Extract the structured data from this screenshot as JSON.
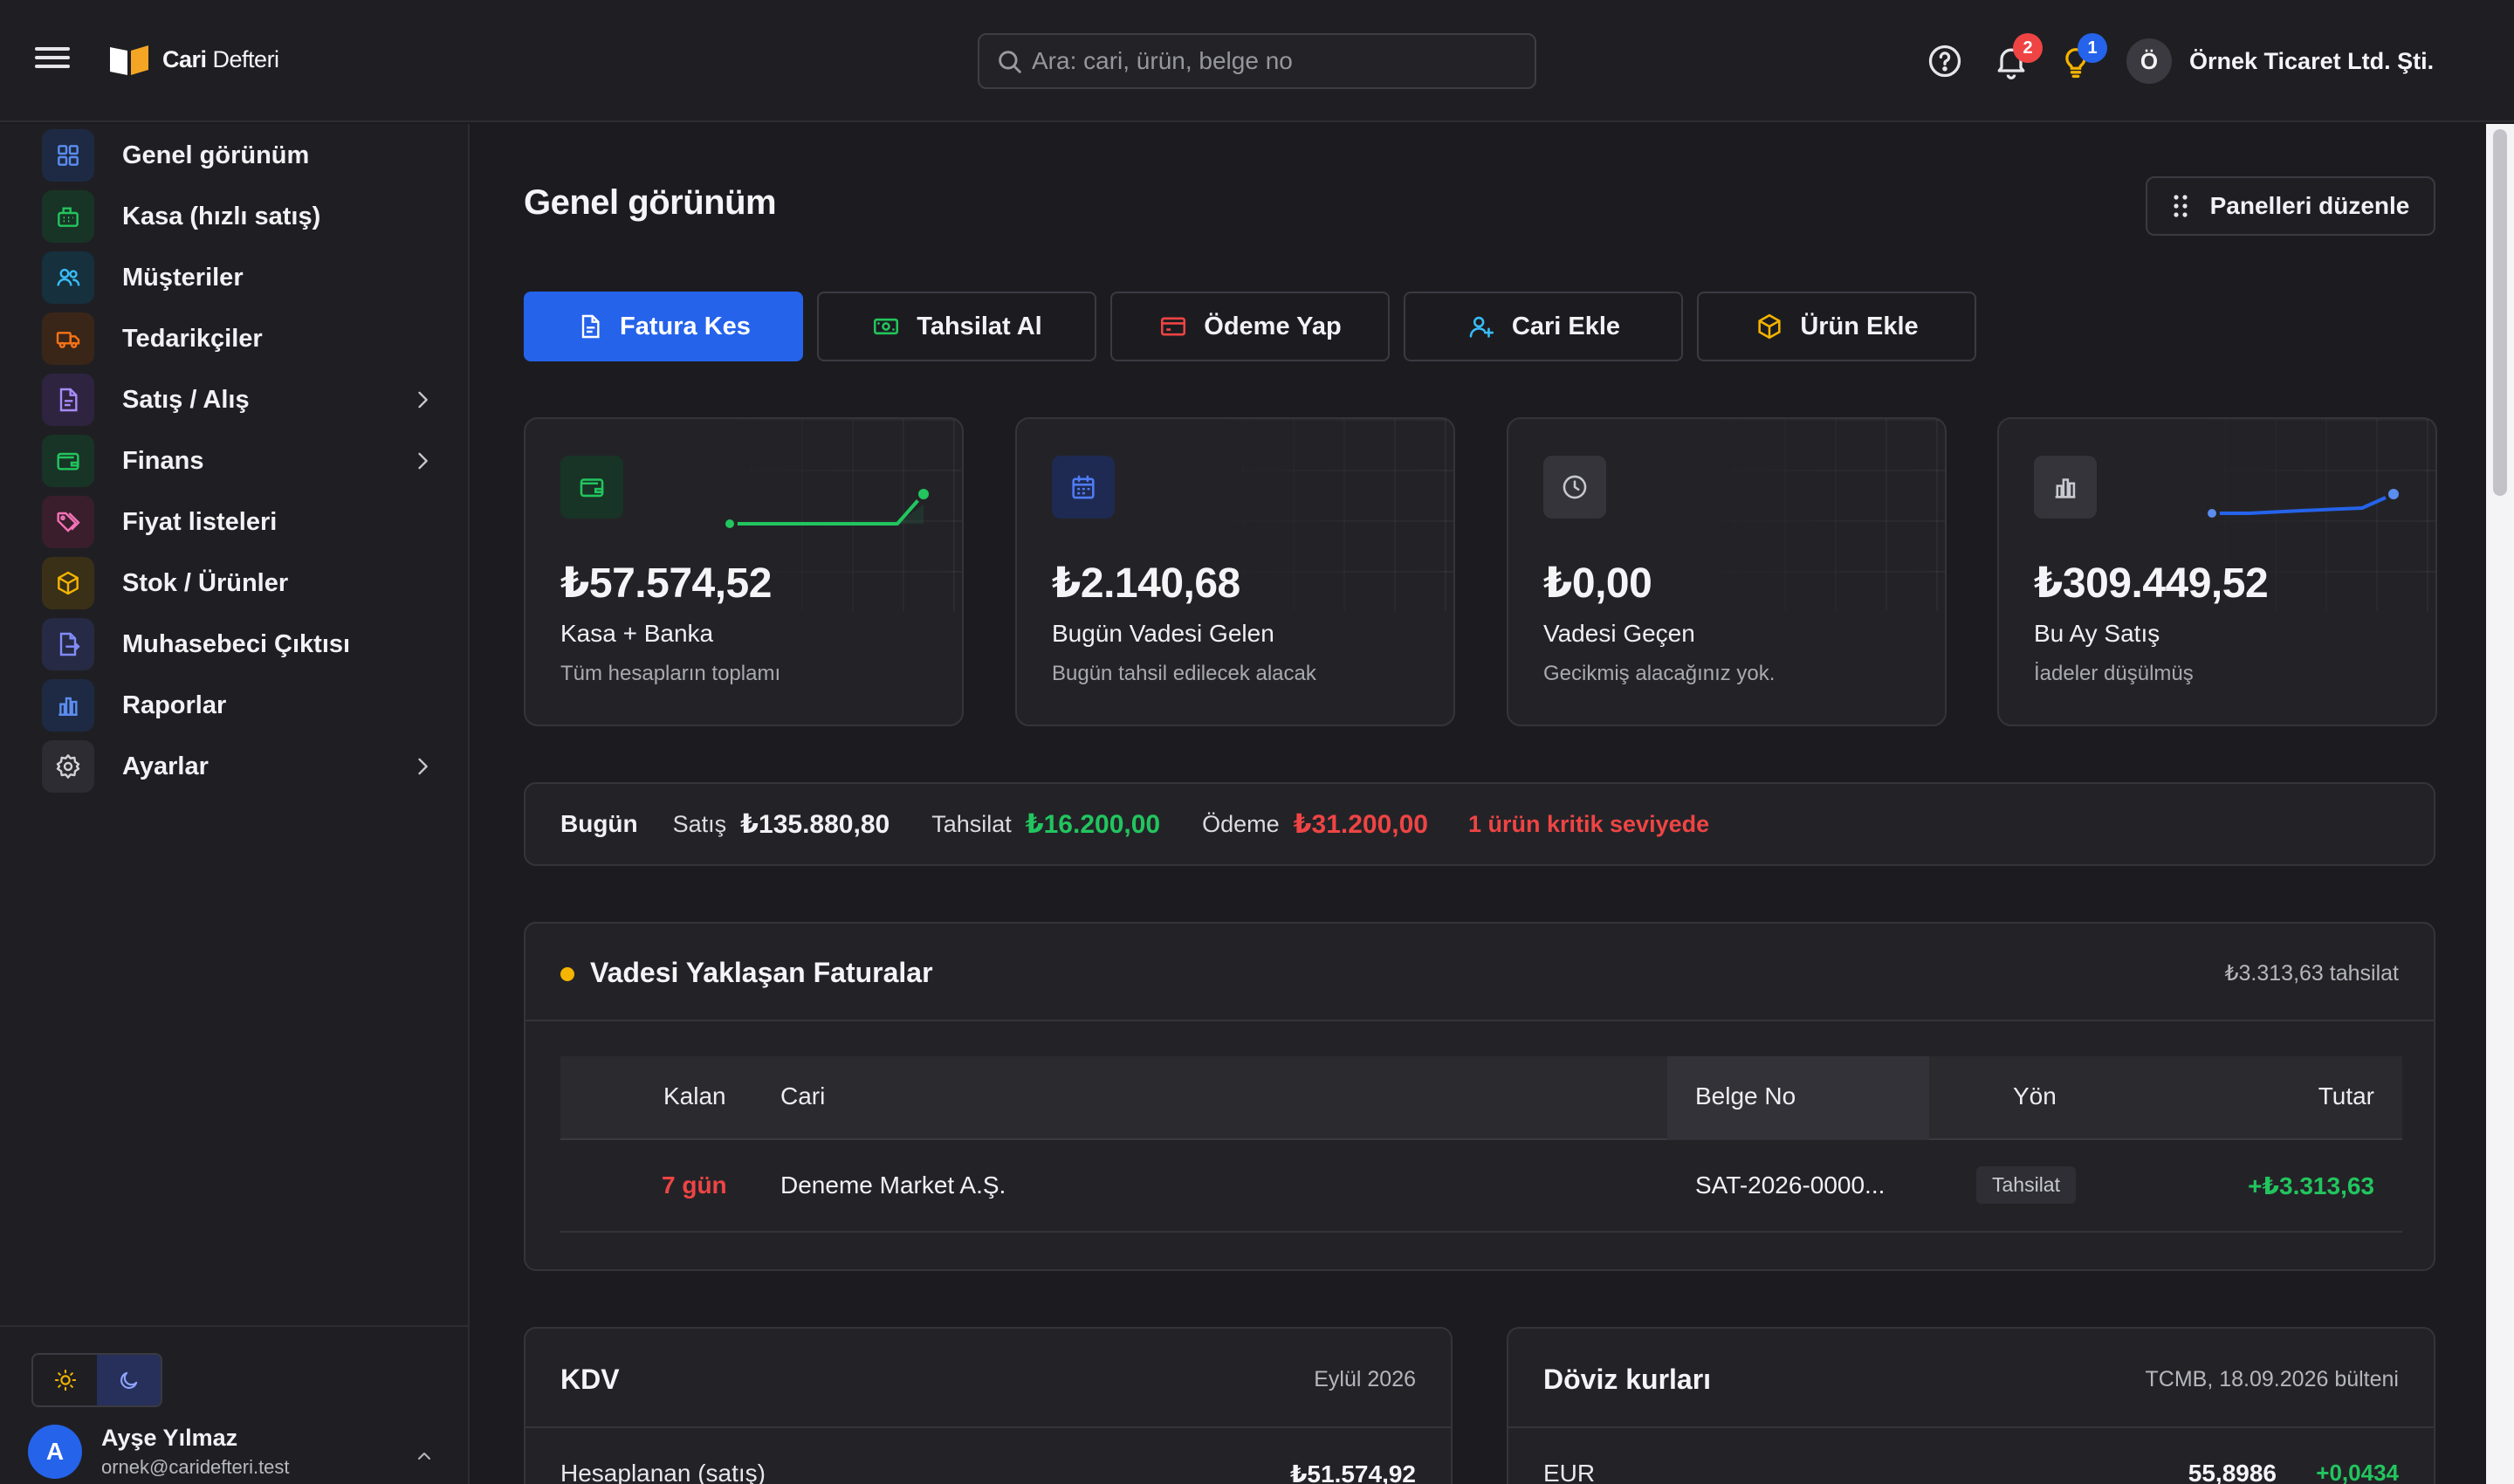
{
  "header": {
    "logo_bold": "Cari",
    "logo_rest": " Defteri",
    "search_placeholder": "Ara: cari, ürün, belge no",
    "notifications_count": "2",
    "tips_count": "1",
    "company_initial": "Ö",
    "company_name": "Örnek Ticaret Ltd. Şti."
  },
  "sidebar": {
    "items": [
      {
        "label": "Genel görünüm",
        "icon": "grid-icon"
      },
      {
        "label": "Kasa (hızlı satış)",
        "icon": "cash-register-icon"
      },
      {
        "label": "Müşteriler",
        "icon": "users-icon"
      },
      {
        "label": "Tedarikçiler",
        "icon": "truck-icon"
      },
      {
        "label": "Satış / Alış",
        "icon": "document-icon"
      },
      {
        "label": "Finans",
        "icon": "wallet-icon"
      },
      {
        "label": "Fiyat listeleri",
        "icon": "tags-icon"
      },
      {
        "label": "Stok / Ürünler",
        "icon": "package-icon"
      },
      {
        "label": "Muhasebeci Çıktısı",
        "icon": "file-export-icon"
      },
      {
        "label": "Raporlar",
        "icon": "bar-chart-icon"
      },
      {
        "label": "Ayarlar",
        "icon": "gear-icon"
      }
    ],
    "user": {
      "initial": "A",
      "name": "Ayşe Yılmaz",
      "email": "ornek@caridefteri.test"
    }
  },
  "main": {
    "title": "Genel görünüm",
    "panel_button": "Panelleri düzenle",
    "actions": [
      "Fatura Kes",
      "Tahsilat Al",
      "Ödeme Yap",
      "Cari Ekle",
      "Ürün Ekle"
    ],
    "stats": [
      {
        "value": "₺57.574,52",
        "label": "Kasa + Banka",
        "sub": "Tüm hesapların toplamı"
      },
      {
        "value": "₺2.140,68",
        "label": "Bugün Vadesi Gelen",
        "sub": "Bugün tahsil edilecek alacak"
      },
      {
        "value": "₺0,00",
        "label": "Vadesi Geçen",
        "sub": "Gecikmiş alacağınız yok."
      },
      {
        "value": "₺309.449,52",
        "label": "Bu Ay Satış",
        "sub": "İadeler düşülmüş"
      }
    ],
    "today": {
      "title": "Bugün",
      "sales_label": "Satış",
      "sales_value": "₺135.880,80",
      "collection_label": "Tahsilat",
      "collection_value": "₺16.200,00",
      "payment_label": "Ödeme",
      "payment_value": "₺31.200,00",
      "warning": "1 ürün kritik seviyede"
    },
    "due": {
      "title": "Vadesi Yaklaşan Faturalar",
      "summary": "₺3.313,63 tahsilat",
      "columns": [
        "Kalan",
        "Cari",
        "Belge No",
        "Yön",
        "Tutar"
      ],
      "rows": [
        {
          "remaining": "7 gün",
          "party": "Deneme Market A.Ş.",
          "doc_no": "SAT-2026-0000...",
          "direction": "Tahsilat",
          "amount": "+₺3.313,63"
        }
      ]
    },
    "kdv": {
      "title": "KDV",
      "period": "Eylül 2026",
      "row_label": "Hesaplanan (satış)",
      "row_value": "₺51.574,92"
    },
    "fx": {
      "title": "Döviz kurları",
      "source": "TCMB, 18.09.2026 bülteni",
      "row_label": "EUR",
      "row_value": "55,8986",
      "row_change": "+0,0434"
    }
  },
  "colors": {
    "accent": "#2563eb",
    "positive": "#22c55e",
    "negative": "#ef4444",
    "warning": "#f5b400"
  }
}
